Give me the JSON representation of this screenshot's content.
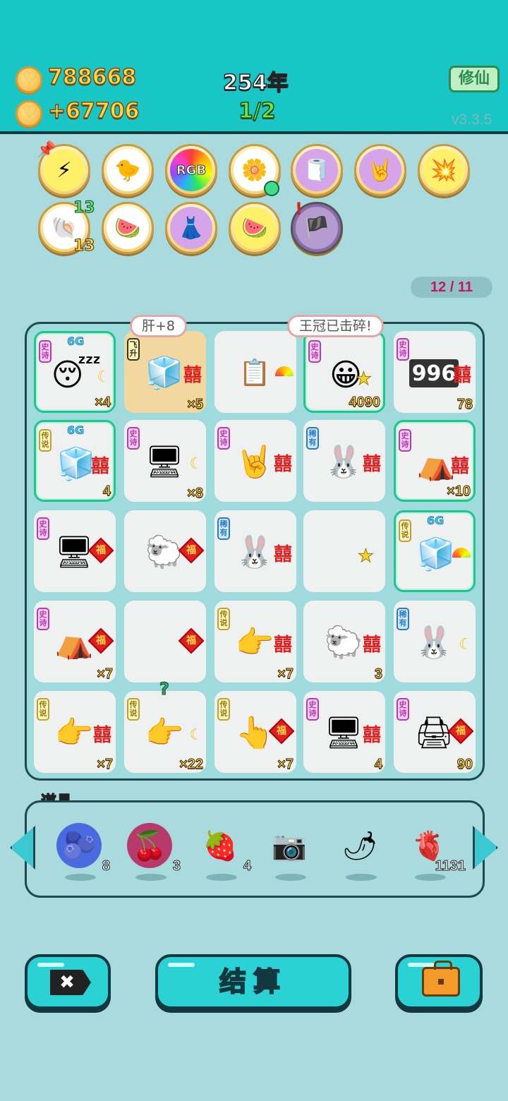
{
  "header": {
    "coins": "788668",
    "income": "+67706",
    "year": "254年",
    "progress": "1/2",
    "cultivate_button": "修仙",
    "version": "v3.3.5"
  },
  "buffs": [
    {
      "name": "lightning-icon",
      "glyph": "⚡"
    },
    {
      "name": "duck-pot-icon",
      "glyph": "🐤"
    },
    {
      "name": "rgb-icon",
      "glyph": "RGB"
    },
    {
      "name": "flower-pot-icon",
      "glyph": "🌼"
    },
    {
      "name": "tissue-box-icon",
      "glyph": "🧻"
    },
    {
      "name": "rock-hand-icon",
      "glyph": "🤘"
    },
    {
      "name": "explosion-icon",
      "glyph": "💥"
    },
    {
      "name": "shell-icon",
      "glyph": "🐚",
      "top_num": "13",
      "bottom_num": "13"
    },
    {
      "name": "fruit-basket-icon",
      "glyph": "🍉"
    },
    {
      "name": "skirt-icon",
      "glyph": "👗"
    },
    {
      "name": "fruit-basket-v-icon",
      "glyph": "🍉"
    },
    {
      "name": "eyepatch-icon",
      "glyph": "🏴‍☠️"
    }
  ],
  "board_counter": "12 / 11",
  "bubbles": {
    "first": "肝+8",
    "second": "王冠已击碎!"
  },
  "tags": {
    "epic": "史诗",
    "legend": "传说",
    "rare": "稀有",
    "fly": "飞升"
  },
  "six_g": "6G",
  "xi": "囍",
  "fu": "福",
  "cells": [
    {
      "name": "king-head",
      "glyph": "😴",
      "count": "×4"
    },
    {
      "name": "fridge",
      "glyph": "🧊",
      "count": "×5"
    },
    {
      "name": "ctrl-c-v",
      "glyph": "📋",
      "count": ""
    },
    {
      "name": "smiling-head",
      "glyph": "😀",
      "count": "4090"
    },
    {
      "name": "996-counter",
      "glyph": "996",
      "count": "78"
    },
    {
      "name": "fridge-legend",
      "glyph": "🧊",
      "count": "4"
    },
    {
      "name": "gpu",
      "glyph": "🖥",
      "count": "×8"
    },
    {
      "name": "rock-hand",
      "glyph": "🤘",
      "count": ""
    },
    {
      "name": "rabbit",
      "glyph": "🐰",
      "count": ""
    },
    {
      "name": "tent",
      "glyph": "⛺",
      "count": "×10"
    },
    {
      "name": "gpu-epic",
      "glyph": "🖥",
      "count": ""
    },
    {
      "name": "sheep",
      "glyph": "🐑",
      "count": ""
    },
    {
      "name": "rabbit-rare",
      "glyph": "🐰",
      "count": ""
    },
    {
      "name": "empty-star",
      "glyph": "",
      "count": ""
    },
    {
      "name": "fridge-legend-2",
      "glyph": "🧊",
      "count": ""
    },
    {
      "name": "tent-2",
      "glyph": "⛺",
      "count": "×7"
    },
    {
      "name": "empty-fu",
      "glyph": "",
      "count": ""
    },
    {
      "name": "pointing-hand",
      "glyph": "👉",
      "count": "×7"
    },
    {
      "name": "king-sheep",
      "glyph": "🐑",
      "count": "3"
    },
    {
      "name": "rabbit-moon",
      "glyph": "🐰",
      "count": ""
    },
    {
      "name": "pointing-hand-2",
      "glyph": "👉",
      "count": "×7"
    },
    {
      "name": "pointing-hand-3",
      "glyph": "👉",
      "count": "×22"
    },
    {
      "name": "pointing-hand-4",
      "glyph": "👆",
      "count": "×7"
    },
    {
      "name": "gpu-2",
      "glyph": "🖥",
      "count": "4"
    },
    {
      "name": "printer",
      "glyph": "🖨",
      "count": "90"
    }
  ],
  "question_mark": "?",
  "tools": {
    "label": "道具",
    "items": [
      {
        "name": "blueberry-icon",
        "glyph": "🫐",
        "count": "8"
      },
      {
        "name": "bayberry-icon",
        "glyph": "🍒",
        "count": "3"
      },
      {
        "name": "strawberry-icon",
        "glyph": "🍓",
        "count": "4"
      },
      {
        "name": "camera-icon",
        "glyph": "📷",
        "count": ""
      },
      {
        "name": "chili-icon",
        "glyph": "🌶",
        "count": ""
      },
      {
        "name": "liver-icon",
        "glyph": "🫀",
        "count": "1131"
      }
    ]
  },
  "buttons": {
    "close_glyph": "✖",
    "settle": "结算"
  },
  "colors": {
    "header_bg": "#19c6c6",
    "page_bg": "#a9dadd",
    "coin_text": "#ffd84a",
    "progress_text": "#6ee54a",
    "counter_text": "#c2185b",
    "highlight_border": "#22c48e"
  }
}
